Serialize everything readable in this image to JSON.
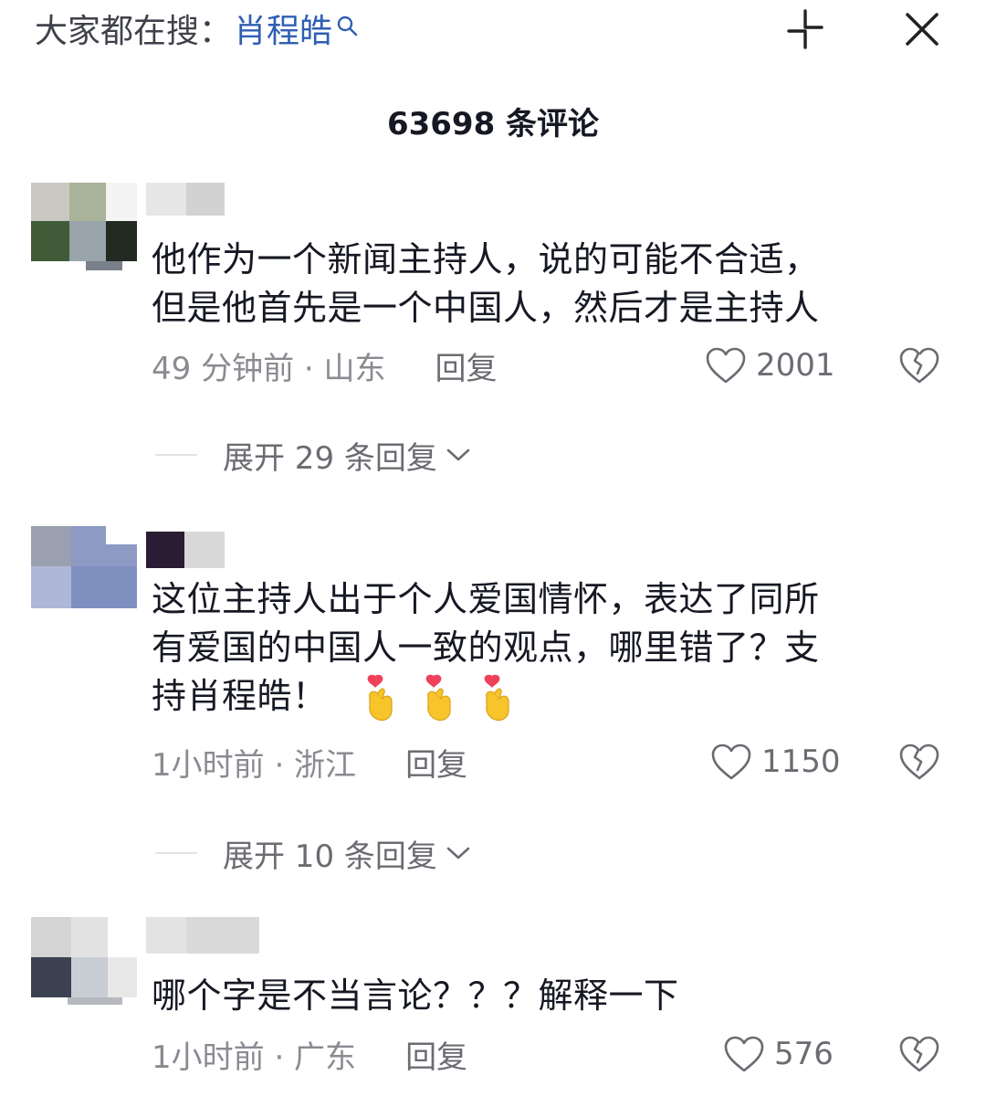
{
  "header": {
    "search_prefix": "大家都在搜：",
    "search_term": "肖程皓",
    "search_icon": "search-icon",
    "collapse_icon": "collapse-icon",
    "close_icon": "close-icon"
  },
  "comments_count_label": "63698 条评论",
  "comments": [
    {
      "text_line1": "他作为一个新闻主持人，说的可能不合适，",
      "text_line2": "但是他首先是一个中国人，然后才是主持人",
      "time_location": "49 分钟前 · 山东",
      "reply_label": "回复",
      "likes": "2001",
      "expand_label": "展开 29 条回复"
    },
    {
      "text_line1": "这位主持人出于个人爱国情怀，表达了同所",
      "text_line2": "有爱国的中国人一致的观点，哪里错了？支",
      "text_line3": "持肖程皓！",
      "emojis": [
        "finger-heart-emoji",
        "finger-heart-emoji",
        "finger-heart-emoji"
      ],
      "time_location": "1小时前 · 浙江",
      "reply_label": "回复",
      "likes": "1150",
      "expand_label": "展开 10 条回复"
    },
    {
      "text_line1": "哪个字是不当言论？？？解释一下",
      "time_location": "1小时前 · 广东",
      "reply_label": "回复",
      "likes": "576"
    }
  ],
  "colors": {
    "search_term": "#2f5fb3",
    "text_primary": "#161823",
    "text_secondary": "#8a8b91",
    "emoji_heart": "#f0415a",
    "emoji_hand": "#f7c52b"
  }
}
